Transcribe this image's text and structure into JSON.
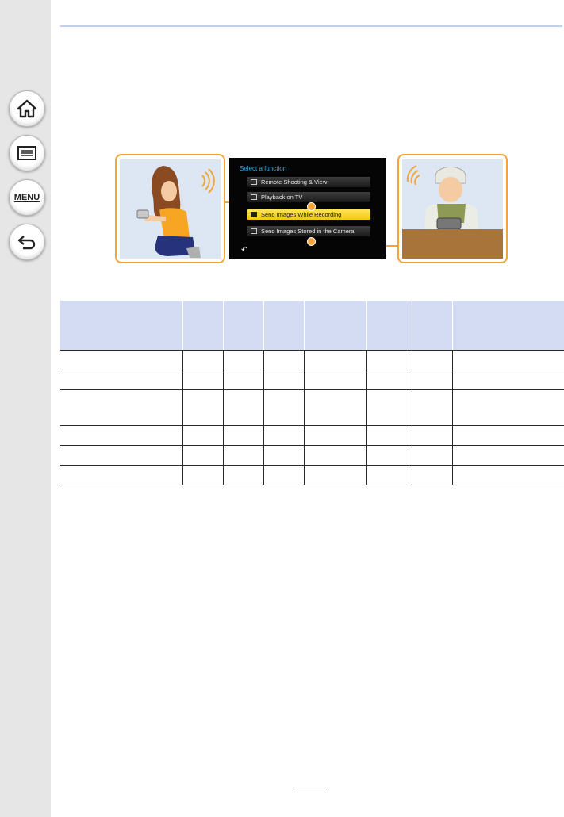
{
  "sidebar": {
    "home_icon": "home-icon",
    "contents_icon": "table-of-contents-icon",
    "menu_label": "MENU",
    "back_icon": "back-arrow-icon"
  },
  "figure": {
    "screen_title": "Select a function",
    "menu_items": [
      {
        "label": "Remote Shooting & View",
        "icon": "remote-shooting-icon"
      },
      {
        "label": "Playback on TV",
        "icon": "tv-icon"
      },
      {
        "label": "Send Images While Recording",
        "icon": "send-recording-icon",
        "selected": true
      },
      {
        "label": "Send Images Stored in the Camera",
        "icon": "send-stored-icon"
      }
    ],
    "back_icon": "return-icon"
  },
  "table": {
    "headers": [
      "",
      "",
      "",
      "",
      "",
      "",
      "",
      ""
    ],
    "rows": [
      [
        "",
        "",
        "",
        "",
        "",
        "",
        "",
        ""
      ],
      [
        "",
        "",
        "",
        "",
        "",
        "",
        "",
        ""
      ],
      [
        "",
        "",
        "",
        "",
        "",
        "",
        "",
        ""
      ],
      [
        "",
        "",
        "",
        "",
        "",
        "",
        "",
        ""
      ],
      [
        "",
        "",
        "",
        "",
        "",
        "",
        "",
        ""
      ],
      [
        "",
        "",
        "",
        "",
        "",
        "",
        "",
        ""
      ]
    ]
  },
  "colors": {
    "accent_orange": "#f2a53a",
    "header_blue": "#d3dcf2",
    "rule_blue": "#c3d0ec",
    "highlight_yellow": "#f0c90c"
  }
}
